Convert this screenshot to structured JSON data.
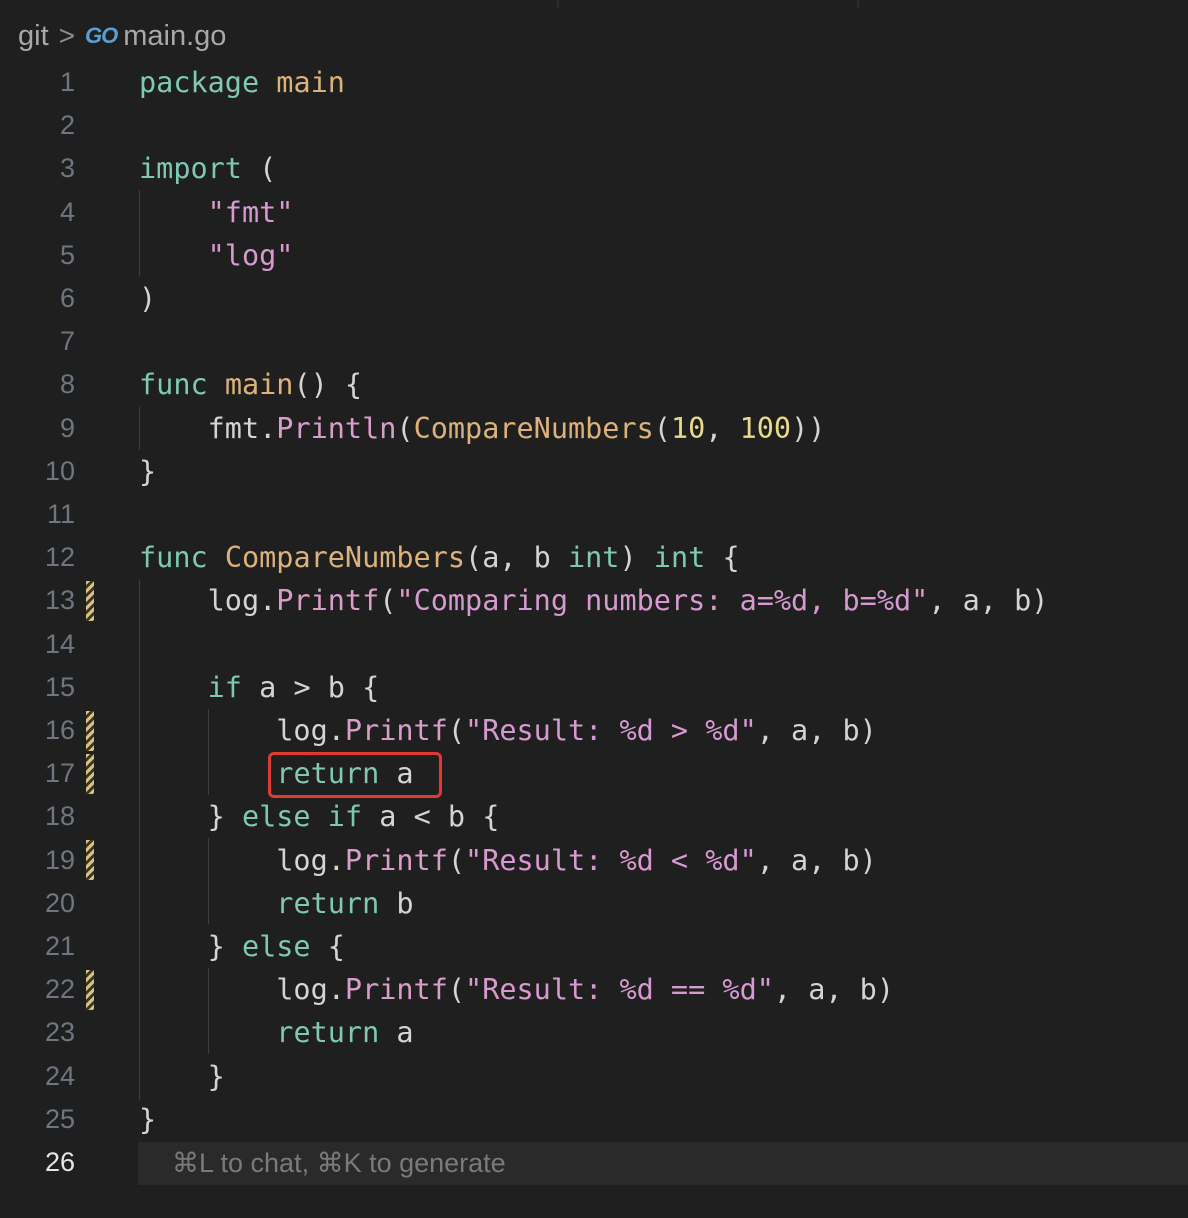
{
  "breadcrumb": {
    "root": "git",
    "separator": ">",
    "file_icon": "go-icon",
    "file_icon_text": "GO",
    "file": "main.go"
  },
  "editor": {
    "active_line": "26",
    "hint": "⌘L to chat, ⌘K to generate",
    "highlight_color": "#e03a33",
    "line_numbers": [
      "1",
      "2",
      "3",
      "4",
      "5",
      "6",
      "7",
      "8",
      "9",
      "10",
      "11",
      "12",
      "13",
      "14",
      "15",
      "16",
      "17",
      "18",
      "19",
      "20",
      "21",
      "22",
      "23",
      "24",
      "25",
      "26"
    ],
    "lines": [
      "package main",
      "",
      "import (",
      "    \"fmt\"",
      "    \"log\"",
      ")",
      "",
      "func main() {",
      "    fmt.Println(CompareNumbers(10, 100))",
      "}",
      "",
      "func CompareNumbers(a, b int) int {",
      "    log.Printf(\"Comparing numbers: a=%d, b=%d\", a, b)",
      "",
      "    if a > b {",
      "        log.Printf(\"Result: %d > %d\", a, b)",
      "        return a",
      "    } else if a < b {",
      "        log.Printf(\"Result: %d < %d\", a, b)",
      "        return b",
      "    } else {",
      "        log.Printf(\"Result: %d == %d\", a, b)",
      "        return a",
      "    }",
      "}",
      ""
    ],
    "modified_lines": [
      "13",
      "16",
      "17",
      "19",
      "22"
    ]
  }
}
